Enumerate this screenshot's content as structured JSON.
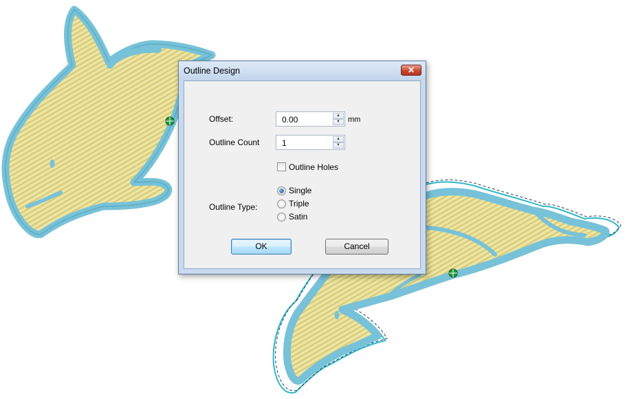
{
  "dialog": {
    "title": "Outline Design",
    "close_glyph": "✕",
    "offset": {
      "label": "Offset:",
      "value": "0.00",
      "unit": "mm"
    },
    "outline_count": {
      "label": "Outline Count",
      "value": "1"
    },
    "outline_holes": {
      "label": "Outline Holes",
      "checked": false
    },
    "outline_type": {
      "label": "Outline Type:",
      "options": [
        {
          "label": "Single",
          "selected": true
        },
        {
          "label": "Triple",
          "selected": false
        },
        {
          "label": "Satin",
          "selected": false
        }
      ]
    },
    "buttons": {
      "ok": "OK",
      "cancel": "Cancel"
    }
  },
  "colors": {
    "fill": "#e6dc8e",
    "outline": "#77c2d8",
    "outline_dark": "#4e9fb8",
    "offset_outline": "#2fb8c8",
    "offset_dash": "#1b3f5c"
  },
  "icons": {
    "spin_up": "▲",
    "spin_down": "▼"
  }
}
